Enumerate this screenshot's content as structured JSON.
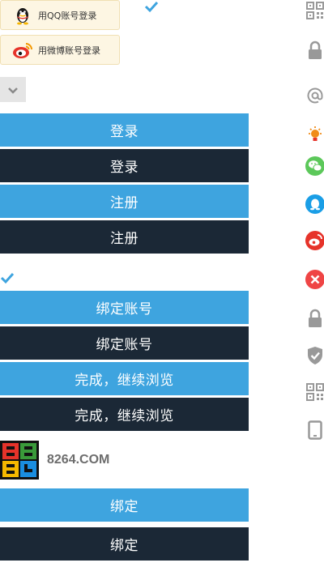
{
  "social_login": {
    "qq_label": "用QQ账号登录",
    "weibo_label": "用微博账号登录"
  },
  "buttons": {
    "login_blue": "登录",
    "login_dark": "登录",
    "register_blue": "注册",
    "register_dark": "注册",
    "bind_account_blue": "绑定账号",
    "bind_account_dark": "绑定账号",
    "done_continue_blue": "完成，继续浏览",
    "done_continue_dark": "完成，继续浏览",
    "bind_blue": "绑定",
    "bind_dark": "绑定"
  },
  "brand": {
    "name": "8264.COM"
  },
  "side_icons": [
    "qrcode-icon",
    "lock-icon",
    "at-icon",
    "bulb-icon",
    "wechat-icon",
    "qq-icon",
    "weibo-icon",
    "close-icon",
    "lock-icon",
    "shield-icon",
    "qrcode-icon",
    "tablet-icon"
  ],
  "colors": {
    "primary_blue": "#3ea4df",
    "dark": "#1b2836",
    "social_bg": "#fdf6e3",
    "wechat_green": "#5cc85a",
    "qq_blue": "#1a9ee6",
    "weibo_red": "#e6332a",
    "close_red": "#ef4545",
    "icon_gray": "#9a9a9a"
  }
}
